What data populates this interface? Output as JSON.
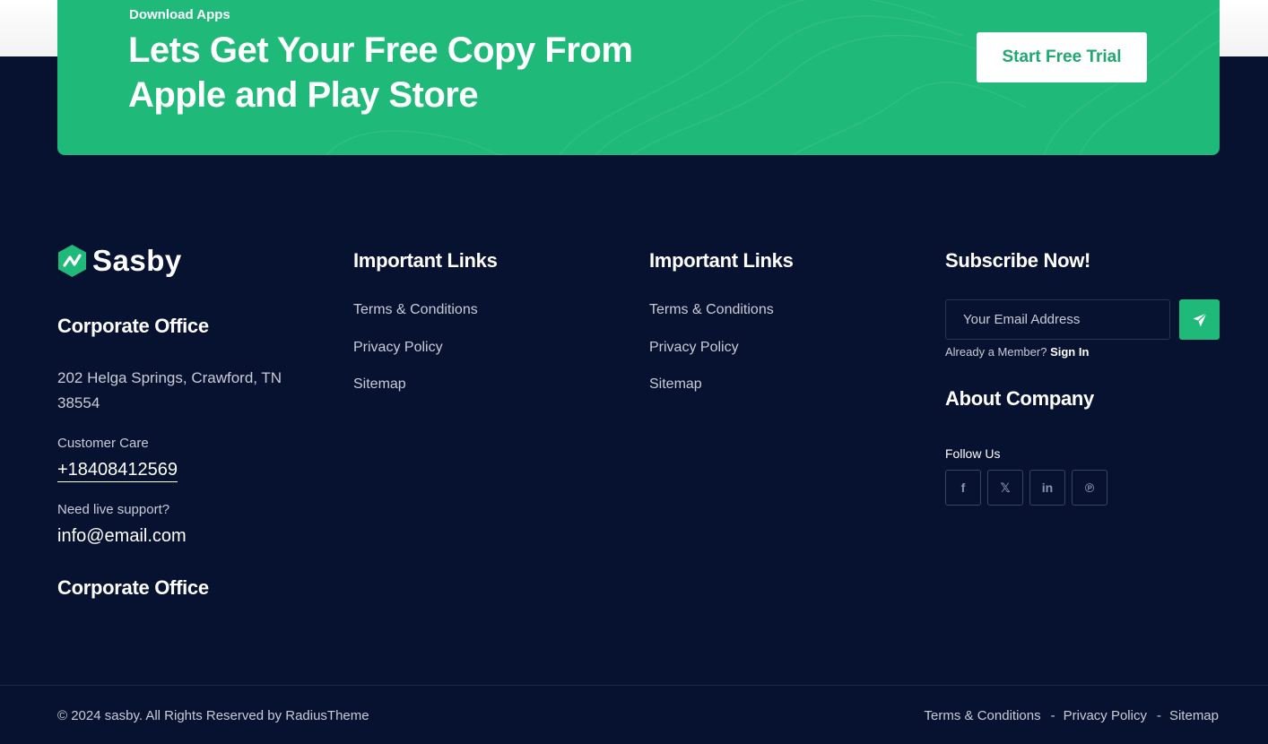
{
  "cta": {
    "eyebrow": "Download Apps",
    "title": "Lets Get Your Free Copy From Apple and Play Store",
    "button": "Start Free Trial",
    "color": "#1fb97a"
  },
  "brand": {
    "name": "Sasby",
    "logo_icon": "logo-hexagon-icon"
  },
  "office": {
    "heading": "Corporate Office",
    "address": "202 Helga Springs, Crawford, TN 38554",
    "care_label": "Customer Care",
    "phone": "+18408412569",
    "support_label": "Need live support?",
    "email": "info@email.com",
    "heading_2": "Corporate Office"
  },
  "links_col_1": {
    "heading": "Important Links",
    "items": [
      "Terms & Conditions",
      "Privacy Policy",
      "Sitemap"
    ]
  },
  "links_col_2": {
    "heading": "Important Links",
    "items": [
      "Terms & Conditions",
      "Privacy Policy",
      "Sitemap"
    ]
  },
  "subscribe": {
    "heading": "Subscribe Now!",
    "placeholder": "Your Email Address",
    "send_icon": "paper-plane-icon",
    "member_text": "Already a Member?",
    "sign_in": "Sign In",
    "about_heading": "About Company",
    "follow_label": "Follow Us",
    "socials": [
      {
        "icon": "facebook-icon",
        "glyph": "f"
      },
      {
        "icon": "x-icon",
        "glyph": "𝕏"
      },
      {
        "icon": "linkedin-icon",
        "glyph": "in"
      },
      {
        "icon": "pinterest-icon",
        "glyph": "℗"
      }
    ]
  },
  "bottom": {
    "copyright": "© 2024 sasby. All Rights Reserved by RadiusTheme",
    "links": [
      "Terms & Conditions",
      "Privacy Policy",
      "Sitemap"
    ],
    "separator": "-"
  }
}
